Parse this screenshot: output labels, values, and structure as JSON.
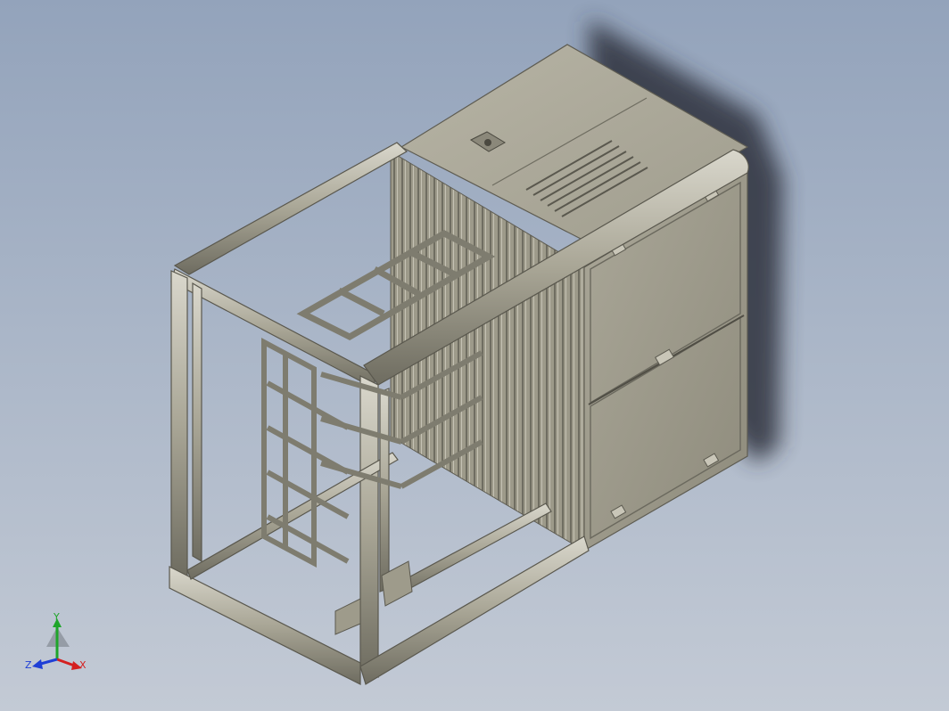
{
  "viewport": {
    "model": "cabinet-frame-assembly"
  },
  "triad": {
    "x_label": "X",
    "y_label": "Y",
    "z_label": "Z",
    "x_color": "#d42020",
    "y_color": "#1fa52a",
    "z_color": "#1f3fd6"
  },
  "colors": {
    "frame": "#a9a696",
    "frame_dark": "#6e6c60",
    "panel": "#9e9b8b",
    "panel_light": "#b5b2a3",
    "shadow": "#2e333d"
  }
}
